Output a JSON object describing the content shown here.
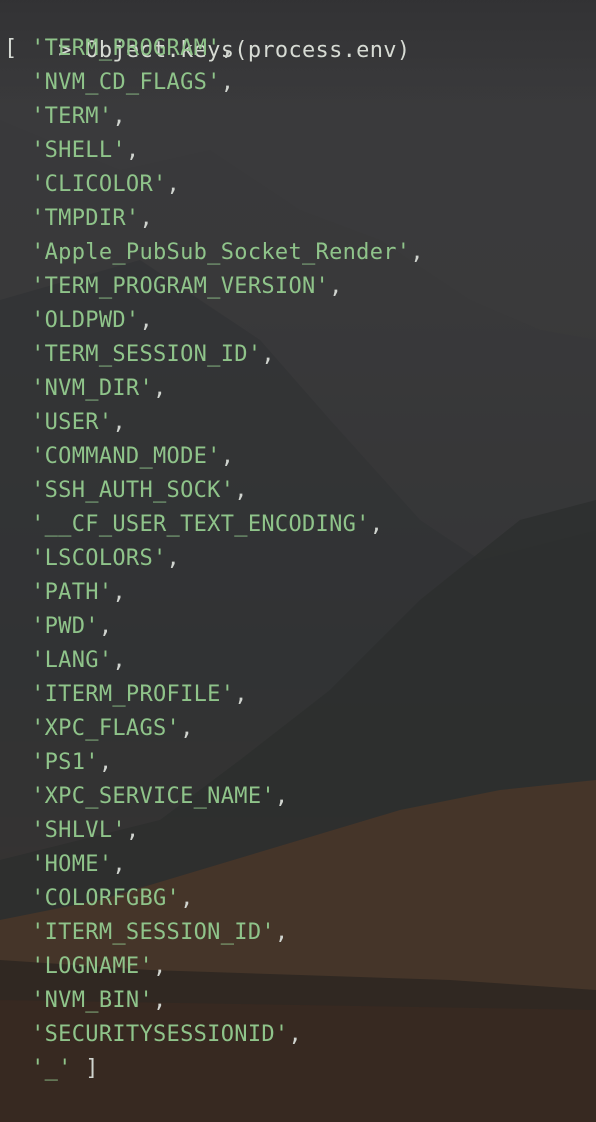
{
  "terminal": {
    "command_prompt": ">",
    "command": "Object.keys(process.env)",
    "open_bracket": "[",
    "close_bracket": "]",
    "keys": [
      "'TERM_PROGRAM'",
      "'NVM_CD_FLAGS'",
      "'TERM'",
      "'SHELL'",
      "'CLICOLOR'",
      "'TMPDIR'",
      "'Apple_PubSub_Socket_Render'",
      "'TERM_PROGRAM_VERSION'",
      "'OLDPWD'",
      "'TERM_SESSION_ID'",
      "'NVM_DIR'",
      "'USER'",
      "'COMMAND_MODE'",
      "'SSH_AUTH_SOCK'",
      "'__CF_USER_TEXT_ENCODING'",
      "'LSCOLORS'",
      "'PATH'",
      "'PWD'",
      "'LANG'",
      "'ITERM_PROFILE'",
      "'XPC_FLAGS'",
      "'PS1'",
      "'XPC_SERVICE_NAME'",
      "'SHLVL'",
      "'HOME'",
      "'COLORFGBG'",
      "'ITERM_SESSION_ID'",
      "'LOGNAME'",
      "'NVM_BIN'",
      "'SECURITYSESSIONID'",
      "'_'"
    ],
    "separator": ",",
    "input_prompt": ">"
  },
  "colors": {
    "string": "#8fc48a",
    "text": "#d7dbd4",
    "cursor": "#e4e4e4"
  }
}
